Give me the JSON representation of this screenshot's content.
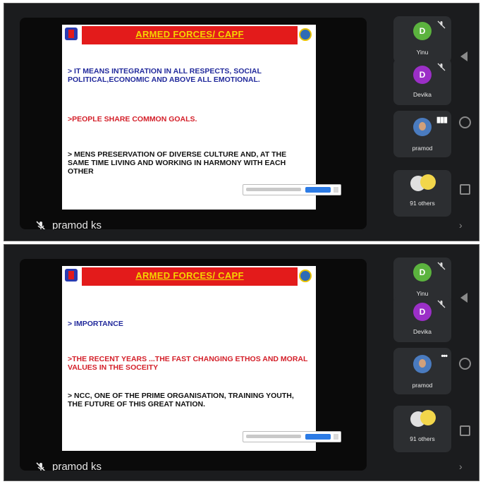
{
  "shots": [
    {
      "slide": {
        "title": "ARMED FORCES/ CAPF",
        "points": [
          {
            "text": "> IT MEANS INTEGRATION IN ALL RESPECTS, SOCIAL POLITICAL,ECONOMIC AND ABOVE ALL EMOTIONAL.",
            "color": "#222a9c"
          },
          {
            "text": ">PEOPLE SHARE COMMON GOALS.",
            "color": "#d4202a"
          },
          {
            "text": "> MENS PRESERVATION OF DIVERSE CULTURE AND, AT THE SAME TIME LIVING AND WORKING IN HARMONY WITH EACH OTHER",
            "color": "#111111"
          }
        ]
      },
      "presenter_name": "pramod ks",
      "participants": [
        {
          "initial": "D",
          "name": "Yinu",
          "avatar_color": "#5bb33e",
          "muted": true
        },
        {
          "initial": "D",
          "name": "Devika",
          "avatar_color": "#9b2fc7",
          "muted": true
        },
        {
          "initial": "",
          "name": "pramod",
          "avatar_color": "#4a7bbf",
          "muted": false
        },
        {
          "initial": "",
          "name": "91 others",
          "avatar_color": "#e0e0e0",
          "muted": false
        }
      ]
    },
    {
      "slide": {
        "title": "ARMED FORCES/ CAPF",
        "points": [
          {
            "text": "> IMPORTANCE",
            "color": "#222a9c"
          },
          {
            "text": ">THE RECENT YEARS ...THE FAST CHANGING ETHOS AND MORAL VALUES IN THE SOCEITY",
            "color": "#d4202a"
          },
          {
            "text": "> NCC, ONE OF THE PRIME ORGANISATION, TRAINING YOUTH, THE FUTURE OF THIS GREAT NATION.",
            "color": "#111111"
          }
        ]
      },
      "presenter_name": "pramod ks",
      "participants": [
        {
          "initial": "D",
          "name": "Yinu",
          "avatar_color": "#5bb33e",
          "muted": true
        },
        {
          "initial": "D",
          "name": "Devika",
          "avatar_color": "#9b2fc7",
          "muted": true
        },
        {
          "initial": "",
          "name": "pramod",
          "avatar_color": "#4a7bbf",
          "muted": false
        },
        {
          "initial": "",
          "name": "91 others",
          "avatar_color": "#e0e0e0",
          "muted": false
        }
      ]
    }
  ],
  "icons": {
    "mic_off": "mic-off-icon",
    "more": "more-options-icon",
    "nav_back": "back-triangle-icon",
    "nav_home": "home-circle-icon",
    "nav_recents": "recents-square-icon"
  }
}
